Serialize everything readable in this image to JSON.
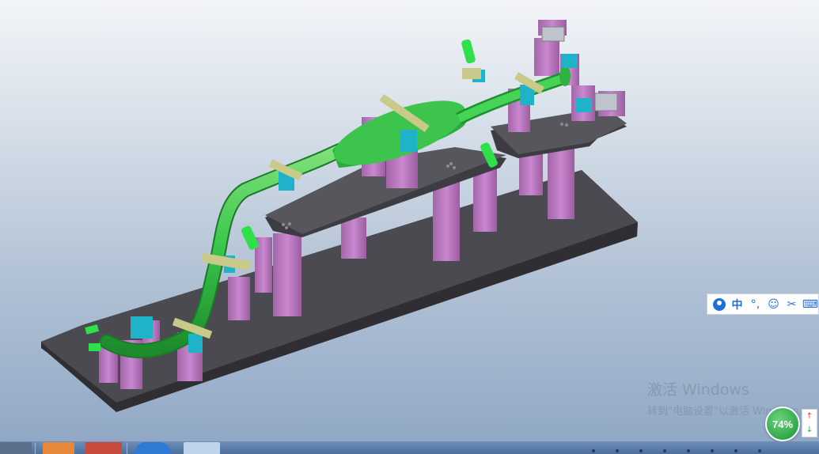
{
  "ime_toolbar": {
    "lang_label": "中",
    "punct_label": "°,",
    "emoji_label": "☺",
    "scissors_label": "✂",
    "keyboard_label": "⌨"
  },
  "watermark": {
    "title": "激活 Windows",
    "subtitle": "转到\"电脑设置\"以激活 Windows。"
  },
  "zoom": {
    "label": "74%"
  },
  "speed": {
    "up": "↑",
    "down": "↓"
  },
  "taskbar": {
    "apps": [
      "app-1",
      "app-2",
      "app-3",
      "app-4",
      "app-5"
    ]
  },
  "colors": {
    "tube": "#36c24a",
    "support": "#c47ec8",
    "plate": "#3f3f44",
    "clamp": "#1fb3c9",
    "bracket": "#c9c98a"
  }
}
